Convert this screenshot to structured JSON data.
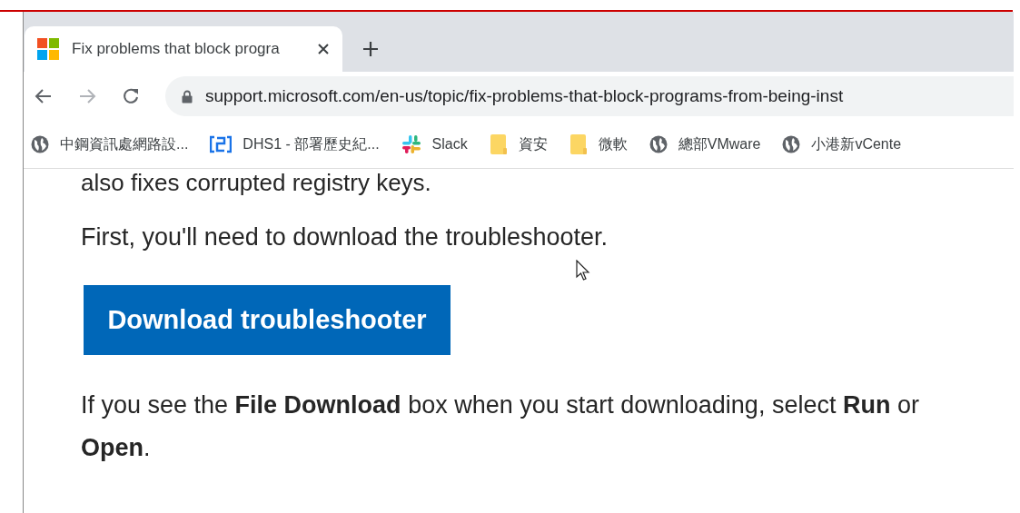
{
  "tab": {
    "title": "Fix problems that block progra",
    "selected": true
  },
  "address_bar": {
    "url": "support.microsoft.com/en-us/topic/fix-problems-that-block-programs-from-being-inst"
  },
  "bookmarks": [
    {
      "kind": "globe",
      "label": "中鋼資訊處網路設..."
    },
    {
      "kind": "app",
      "label": "DHS1 - 部署歷史紀..."
    },
    {
      "kind": "slack",
      "label": "Slack"
    },
    {
      "kind": "folder",
      "label": "資安"
    },
    {
      "kind": "folder",
      "label": "微軟"
    },
    {
      "kind": "globe",
      "label": "總部VMware"
    },
    {
      "kind": "globe",
      "label": "小港新vCente"
    }
  ],
  "content": {
    "partial_line": "also fixes corrupted registry keys.",
    "intro": "First, you'll need to download the troubleshooter.",
    "button": "Download troubleshooter",
    "note": "If you see the **File Download** box when you start downloading, select **Run** or **Open**."
  }
}
